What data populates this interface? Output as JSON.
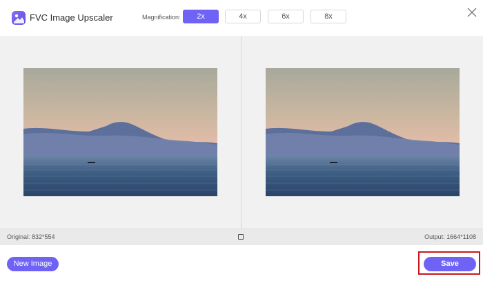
{
  "app": {
    "title": "FVC Image Upscaler"
  },
  "magnification": {
    "label": "Magnification:",
    "options": [
      "2x",
      "4x",
      "6x",
      "8x"
    ],
    "selected": "2x"
  },
  "info": {
    "original": "Original: 832*554",
    "output": "Output: 1664*1108"
  },
  "footer": {
    "new_image_label": "New Image",
    "save_label": "Save"
  },
  "icons": {
    "logo": "app-logo-icon",
    "close": "close-icon",
    "compare": "compare-view-icon"
  },
  "colors": {
    "accent": "#6f63f5",
    "highlight": "#c8161e",
    "preview_bg": "#f1f1f2"
  }
}
